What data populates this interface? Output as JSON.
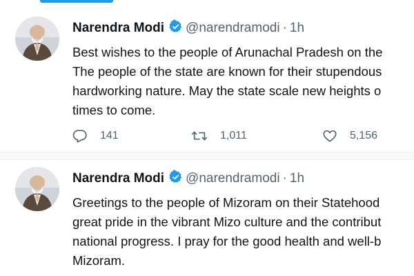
{
  "tweets": [
    {
      "author_name": "Narendra Modi",
      "handle": "@narendramodi",
      "separator": "·",
      "time": "1h",
      "lines": [
        "Best wishes to the people of Arunachal Pradesh on the",
        "The people of the state are known for their stupendous",
        "hardworking nature. May the state scale new heights o",
        "times to come."
      ],
      "replies": "141",
      "retweets": "1,011",
      "likes": "5,156"
    },
    {
      "author_name": "Narendra Modi",
      "handle": "@narendramodi",
      "separator": "·",
      "time": "1h",
      "lines": [
        "Greetings to the people of Mizoram on their Statehood",
        "great pride in the vibrant Mizo culture and the contribut",
        "national progress. I pray for the good health and well-b",
        "Mizoram."
      ]
    }
  ],
  "icons": {
    "verified": "verified-badge-icon",
    "reply": "reply-icon",
    "retweet": "retweet-icon",
    "like": "heart-icon"
  },
  "colors": {
    "accent": "#1d9bf0",
    "text": "#0f1419",
    "secondary": "#536471"
  }
}
